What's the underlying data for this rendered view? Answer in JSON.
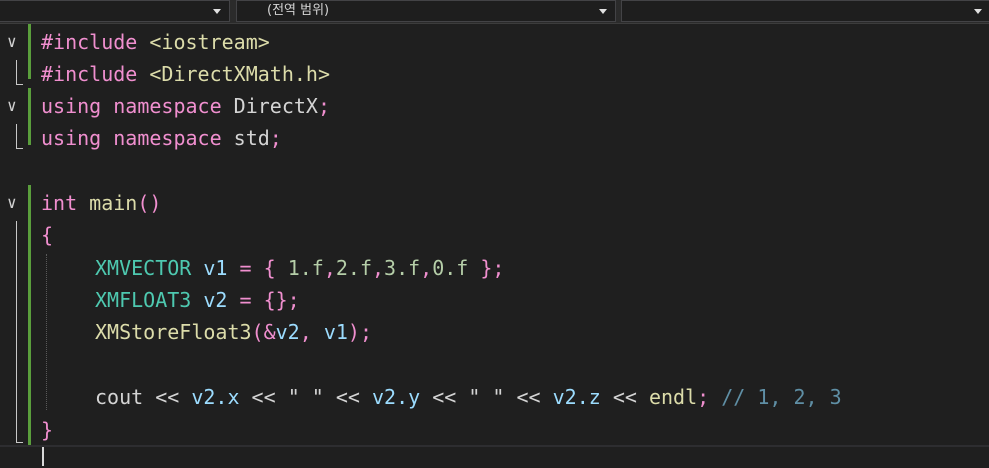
{
  "navbar": {
    "dropdown1": "",
    "dropdown2": "(전역 범위)",
    "dropdown3": ""
  },
  "code": {
    "l1": {
      "kw": "#include",
      "arg": "<iostream>"
    },
    "l2": {
      "kw": "#include",
      "arg": "<DirectXMath.h>"
    },
    "l3": {
      "kw": "using namespace",
      "name": "DirectX",
      "semi": ";"
    },
    "l4": {
      "kw": "using namespace",
      "name": "std",
      "semi": ";"
    },
    "l6": {
      "kw": "int",
      "fn": "main",
      "parens": "()"
    },
    "l7": {
      "brace": "{"
    },
    "l8": {
      "type": "XMVECTOR",
      "var": "v1",
      "eq": " = ",
      "open": "{",
      "n1": "1.f",
      "n2": "2.f",
      "n3": "3.f",
      "n4": "0.f",
      "close": "};"
    },
    "l9": {
      "type": "XMFLOAT3",
      "var": "v2",
      "eq": " = ",
      "init": "{};"
    },
    "l10": {
      "fn": "XMStoreFloat3",
      "open": "(&",
      "a1": "v2",
      "sep": ", ",
      "a2": "v1",
      "close": ");"
    },
    "l12": {
      "cout": "cout",
      "op": " << ",
      "x": "v2.x",
      "s1": "\" \"",
      "y": "v2.y",
      "s2": "\" \"",
      "z": "v2.z",
      "endl": "endl",
      "semi": ";",
      "comment": " // 1, 2, 3"
    },
    "l13": {
      "brace": "}"
    }
  }
}
